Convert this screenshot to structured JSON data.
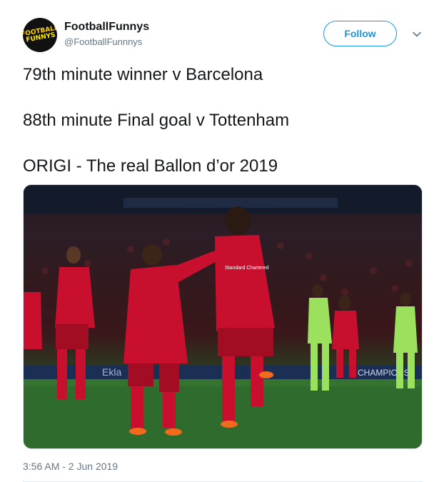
{
  "user": {
    "display_name": "FootballFunnys",
    "handle": "@FootballFunnnys",
    "avatar_logo_line1": "FOOTBALL",
    "avatar_logo_line2": "FUNNYS"
  },
  "follow_label": "Follow",
  "tweet_lines": [
    "79th minute winner v Barcelona",
    "88th minute Final goal v Tottenham",
    "ORIGI - The real Ballon d’or 2019"
  ],
  "media": {
    "shirt_sponsor": "Standard Chartered",
    "board_text_1": "Ekla",
    "board_text_2": "CHAMPIONS"
  },
  "timestamp": "3:56 AM - 2 Jun 2019",
  "colors": {
    "accent": "#1b95e0",
    "text": "#14171a",
    "secondary_text": "#657786",
    "liverpool_red": "#c8102e",
    "barca_green": "#9be15d"
  },
  "icons": {
    "caret": "chevron-down-icon"
  }
}
